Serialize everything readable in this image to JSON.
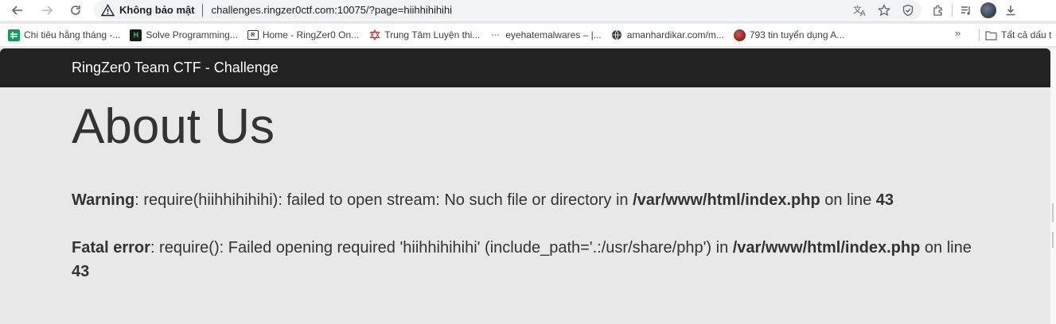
{
  "browser": {
    "security_label": "Không bảo mật",
    "url": "challenges.ringzer0ctf.com:10075/?page=hiihhihihihi"
  },
  "bookmarks": [
    {
      "label": "Chi tiêu hằng tháng -...",
      "icon": "sheets-icon",
      "color": "#0f9d58"
    },
    {
      "label": "Solve Programming...",
      "icon": "hackerrank-icon",
      "color": "#1a1a1a"
    },
    {
      "label": "Home - RingZer0 On...",
      "icon": "ringzer0-icon",
      "color": "#333333"
    },
    {
      "label": "Trung Tâm Luyện thi...",
      "icon": "star-of-david-icon",
      "color": "#c62828"
    },
    {
      "label": "eyehatemalwares – |...",
      "icon": "dash-icon",
      "color": "#9e9e9e"
    },
    {
      "label": "amanhardikar.com/m...",
      "icon": "globe-icon",
      "color": "#3c4043"
    },
    {
      "label": "793 tin tuyển dụng A...",
      "icon": "site-icon",
      "color": "#8b1a1a"
    }
  ],
  "bookmarks_folder": "Tất cả dấu t",
  "page": {
    "brand": "RingZer0 Team CTF - Challenge",
    "title": "About Us",
    "warning": {
      "label": "Warning",
      "text": ": require(hiihhihihihi): failed to open stream: No such file or directory in ",
      "file": "/var/www/html/index.php",
      "mid": " on line ",
      "line": "43"
    },
    "fatal": {
      "label": "Fatal error",
      "text": ": require(): Failed opening required 'hiihhihihihi' (include_path='.:/usr/share/php') in ",
      "file": "/var/www/html/index.php",
      "mid": " on line ",
      "line": "43"
    }
  }
}
